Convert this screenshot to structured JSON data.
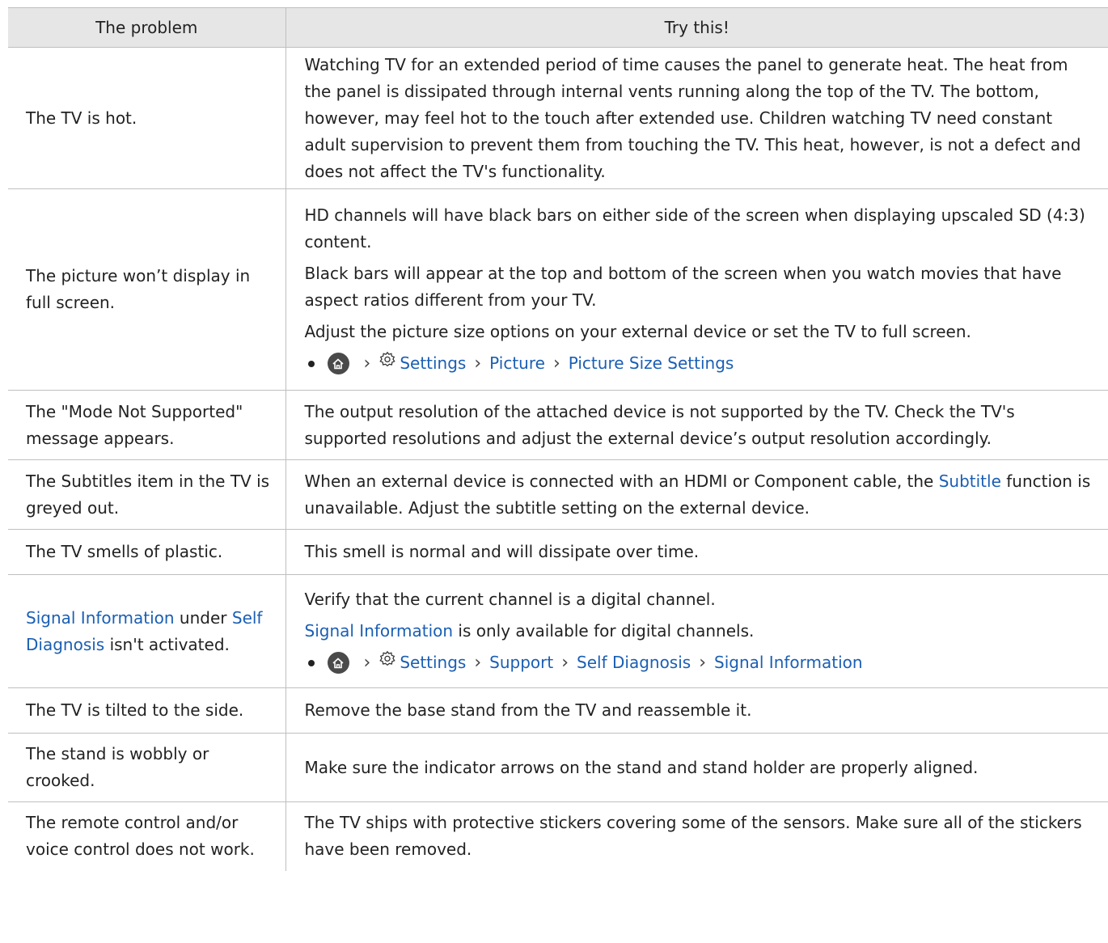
{
  "header": {
    "problem": "The problem",
    "solution": "Try this!"
  },
  "rows": [
    {
      "problem": "The TV is hot.",
      "solution": [
        "Watching TV for an extended period of time causes the panel to generate heat. The heat from the panel is dissipated through internal vents running along the top of the TV. The bottom, however, may feel hot to the touch after extended use. Children watching TV need constant adult supervision to prevent them from touching the TV. This heat, however, is not a defect and does not affect the TV's functionality."
      ]
    },
    {
      "problem": "The picture won’t display in full screen.",
      "solution": [
        "HD channels will have black bars on either side of the screen when displaying upscaled SD (4:3) content.",
        "Black bars will appear at the top and bottom of the screen when you watch movies that have aspect ratios different from your TV.",
        "Adjust the picture size options on your external device or set the TV to full screen."
      ],
      "path": [
        "Settings",
        "Picture",
        "Picture Size Settings"
      ]
    },
    {
      "problem": "The \"Mode Not Supported\" message appears.",
      "solution": [
        "The output resolution of the attached device is not supported by the TV. Check the TV's supported resolutions and adjust the external device’s output resolution accordingly."
      ]
    },
    {
      "problem": "The Subtitles item in the TV is greyed out.",
      "solution_pre": "When an external device is connected with an HDMI or Component cable, the ",
      "solution_link": "Subtitle",
      "solution_post": " function is unavailable. Adjust the subtitle setting on the external device."
    },
    {
      "problem": "The TV smells of plastic.",
      "solution": [
        "This smell is normal and will dissipate over time."
      ]
    },
    {
      "problem_link1": "Signal Information",
      "problem_mid": " under ",
      "problem_link2": "Self Diagnosis",
      "problem_post": " isn't activated.",
      "solution": [
        "Verify that the current channel is a digital channel."
      ],
      "solution_link": "Signal Information",
      "solution_post": " is only available for digital channels.",
      "path": [
        "Settings",
        "Support",
        "Self Diagnosis",
        "Signal Information"
      ]
    },
    {
      "problem": "The TV is tilted to the side.",
      "solution": [
        "Remove the base stand from the TV and reassemble it."
      ]
    },
    {
      "problem": "The stand is wobbly or crooked.",
      "solution": [
        "Make sure the indicator arrows on the stand and stand holder are properly aligned."
      ]
    },
    {
      "problem": "The remote control and/or voice control does not work.",
      "solution": [
        "The TV ships with protective stickers covering some of the sensors. Make sure all of the stickers have been removed."
      ]
    }
  ],
  "icons": {
    "home": "home-icon",
    "settings": "gear-icon",
    "separator": "chevron-right-icon"
  },
  "colors": {
    "link": "#1a5fb4",
    "header_bg": "#e6e6e6"
  }
}
